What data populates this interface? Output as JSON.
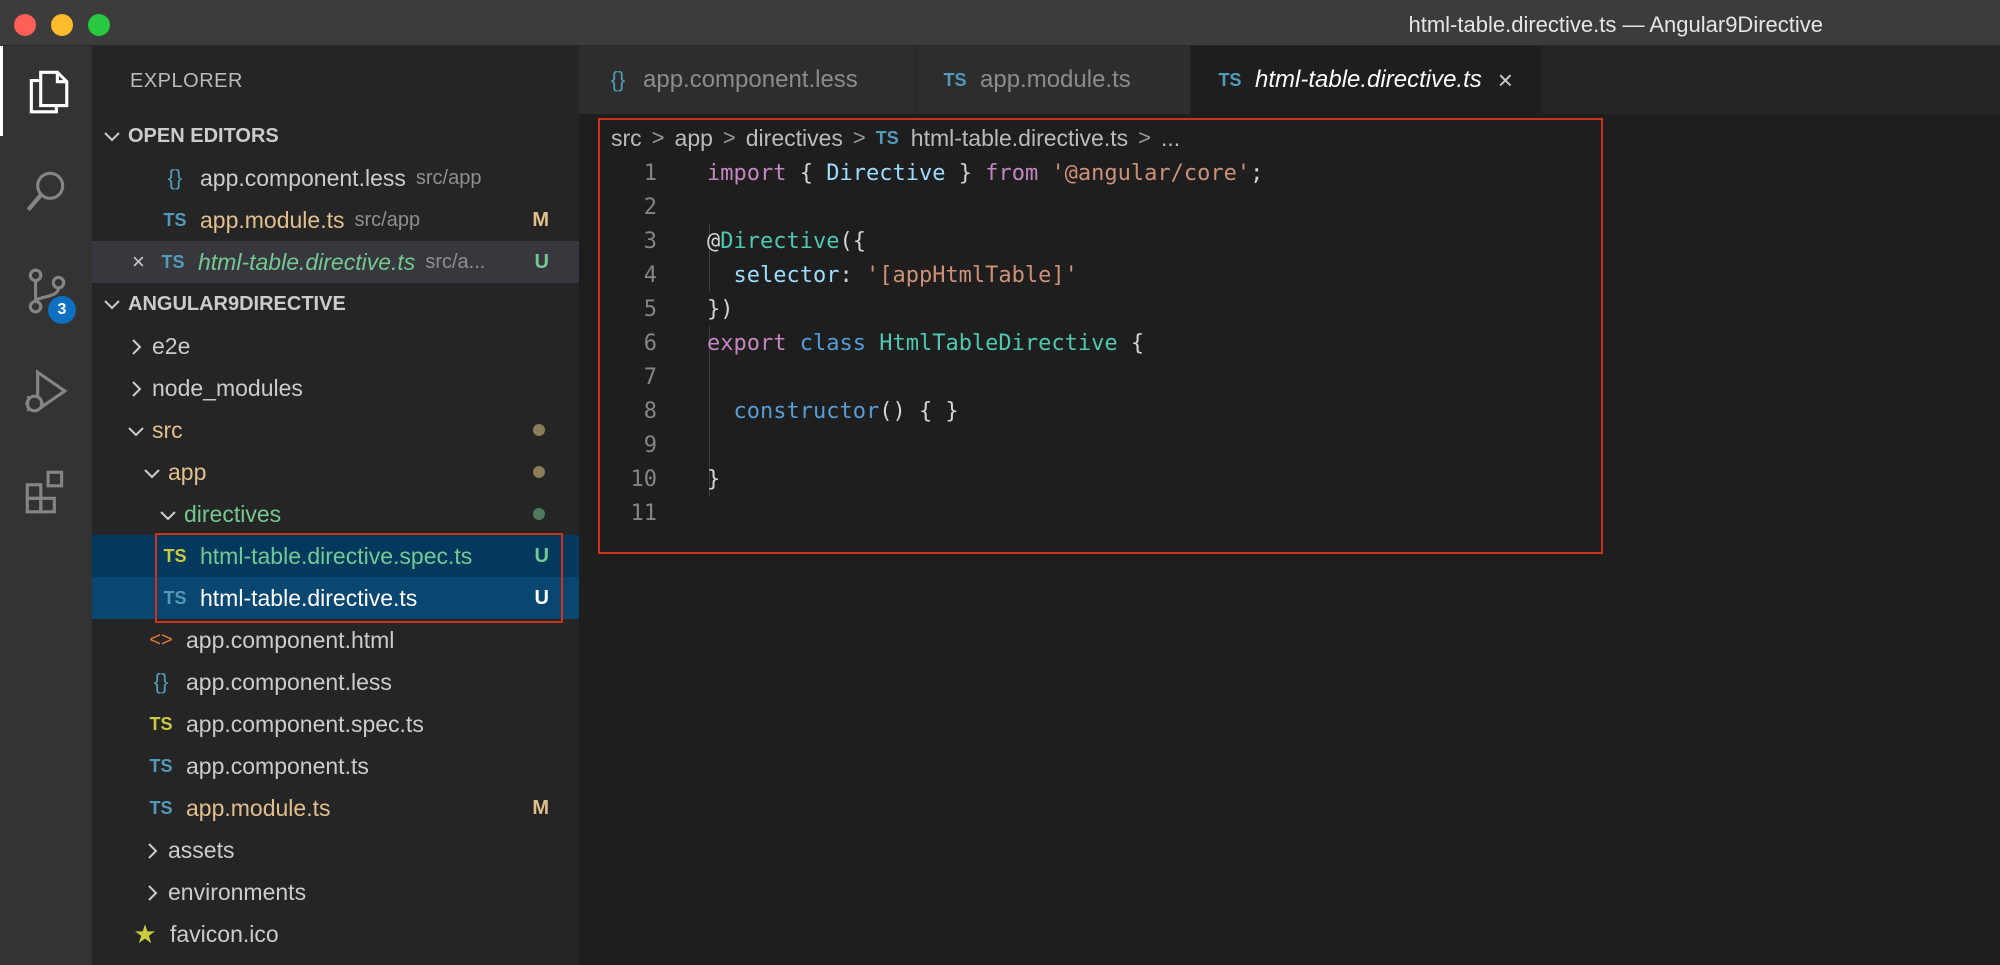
{
  "window": {
    "title": "html-table.directive.ts — Angular9Directive"
  },
  "activity": {
    "scm_badge": "3"
  },
  "explorer": {
    "title": "EXPLORER",
    "open_editors_label": "OPEN EDITORS",
    "open_editors": [
      {
        "name": "app.component.less",
        "path": "src/app",
        "flag": ""
      },
      {
        "name": "app.module.ts",
        "path": "src/app",
        "flag": "M"
      },
      {
        "name": "html-table.directive.ts",
        "path": "src/a...",
        "flag": "U",
        "close": "×"
      }
    ],
    "project_label": "ANGULAR9DIRECTIVE",
    "tree": {
      "e2e": "e2e",
      "node_modules": "node_modules",
      "src": "src",
      "app": "app",
      "directives": "directives",
      "spec_file": "html-table.directive.spec.ts",
      "spec_flag": "U",
      "directive_file": "html-table.directive.ts",
      "directive_flag": "U",
      "component_html": "app.component.html",
      "component_less": "app.component.less",
      "component_spec": "app.component.spec.ts",
      "component_ts": "app.component.ts",
      "module_ts": "app.module.ts",
      "module_flag": "M",
      "assets": "assets",
      "environments": "environments",
      "favicon": "favicon.ico"
    }
  },
  "tabs": [
    {
      "icon": "{}",
      "label": "app.component.less"
    },
    {
      "icon": "TS",
      "label": "app.module.ts"
    },
    {
      "icon": "TS",
      "label": "html-table.directive.ts",
      "close": "×"
    }
  ],
  "breadcrumb": {
    "parts": [
      "src",
      "app",
      "directives"
    ],
    "file_icon": "TS",
    "file": "html-table.directive.ts",
    "tail": "...",
    "sep": ">"
  },
  "code": {
    "line_numbers": [
      "1",
      "2",
      "3",
      "4",
      "5",
      "6",
      "7",
      "8",
      "9",
      "10",
      "11"
    ],
    "l1": {
      "kw": "import",
      "p1": " { ",
      "name": "Directive",
      "p2": " } ",
      "from": "from",
      "sp": " ",
      "str": "'@angular/core'",
      "end": ";"
    },
    "l3": {
      "at": "@",
      "fn": "Directive",
      "p": "({"
    },
    "l4": {
      "key": "selector",
      "colon": ": ",
      "str": "'[appHtmlTable]'"
    },
    "l5": {
      "p": "})"
    },
    "l6": {
      "kw1": "export",
      "kw2": "class",
      "type": "HtmlTableDirective",
      "p": " {"
    },
    "l8": {
      "ctor": "constructor",
      "p": "() { }"
    },
    "l10": {
      "p": "}"
    }
  },
  "icon_names": [
    "files-icon",
    "search-icon",
    "source-control-icon",
    "run-debug-icon",
    "extensions-icon"
  ]
}
